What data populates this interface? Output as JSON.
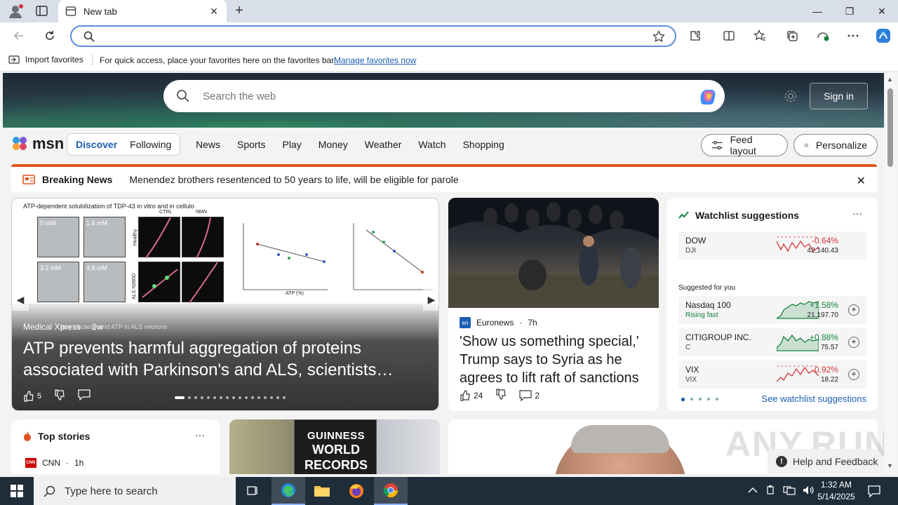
{
  "browser": {
    "tab": {
      "title": "New tab"
    },
    "address": {
      "value": "",
      "placeholder": ""
    },
    "window_controls": {
      "minimize": "—",
      "maximize": "❐",
      "close": "✕"
    }
  },
  "favorites_bar": {
    "import_label": "Import favorites",
    "message": "For quick access, place your favorites here on the favorites bar.",
    "manage_link": "Manage favorites now"
  },
  "hero": {
    "search_placeholder": "Search the web",
    "sign_in": "Sign in"
  },
  "msn": {
    "logo_text": "msn",
    "tabs": {
      "discover": "Discover",
      "following": "Following"
    },
    "nav": [
      "News",
      "Sports",
      "Play",
      "Money",
      "Weather",
      "Watch",
      "Shopping"
    ],
    "feed_layout": "Feed layout",
    "personalize": "Personalize"
  },
  "breaking": {
    "title": "Breaking News",
    "text": "Menendez brothers resentenced to 50 years to life, will be eligible for parole"
  },
  "lead_card": {
    "figure_title": "ATP-dependent solubilization of TDP-43 in vitro and in cellulo",
    "figure_labels": [
      "0 mM",
      "1.6 mM",
      "3.2 mM",
      "4.8 mM",
      "CTRL",
      "NMN",
      "Healthy",
      "ALS N390D"
    ],
    "figure_axis": [
      "ATP (%)",
      "Number of TDP43 aggregates / 100 μm² axon",
      "Cytosolic fluidity (%)"
    ],
    "caption_fragment": "lear viscosity and ATP in ALS neurons",
    "source": "Medical Xpress",
    "age": "2w",
    "headline": "ATP prevents harmful aggregation of proteins associated with Parkinson's and ALS, scientists…",
    "likes": "5"
  },
  "mid_card": {
    "source": "Euronews",
    "age": "7h",
    "source_logo": "en",
    "headline": "'Show us something special,' Trump says to Syria as he agrees to lift raft of sanctions",
    "likes": "24",
    "comments": "2"
  },
  "watchlist": {
    "title": "Watchlist suggestions",
    "more": "···",
    "suggested_label": "Suggested for you",
    "link": "See watchlist suggestions",
    "items": [
      {
        "name": "DOW",
        "sub": "DJI",
        "pct": "-0.64%",
        "value": "42,140.43",
        "trend": "down"
      },
      {
        "name": "Nasdaq 100",
        "sub": "Rising fast",
        "pct": "+1.58%",
        "value": "21,197.70",
        "trend": "up"
      },
      {
        "name": "CITIGROUP INC.",
        "sub": "C",
        "pct": "+0.88%",
        "value": "75.57",
        "trend": "up"
      },
      {
        "name": "VIX",
        "sub": "VIX",
        "pct": "-0.92%",
        "value": "18.22",
        "trend": "down"
      }
    ]
  },
  "top_stories": {
    "title": "Top stories",
    "more": "···",
    "source": "CNN",
    "age": "1h"
  },
  "guinness": {
    "line1": "GUINNESS",
    "line2": "WORLD",
    "line3": "RECORDS"
  },
  "watermark": "ANY.RUN",
  "help": "Help and Feedback",
  "taskbar": {
    "search_placeholder": "Type here to search",
    "time": "1:32 AM",
    "date": "5/14/2025"
  }
}
